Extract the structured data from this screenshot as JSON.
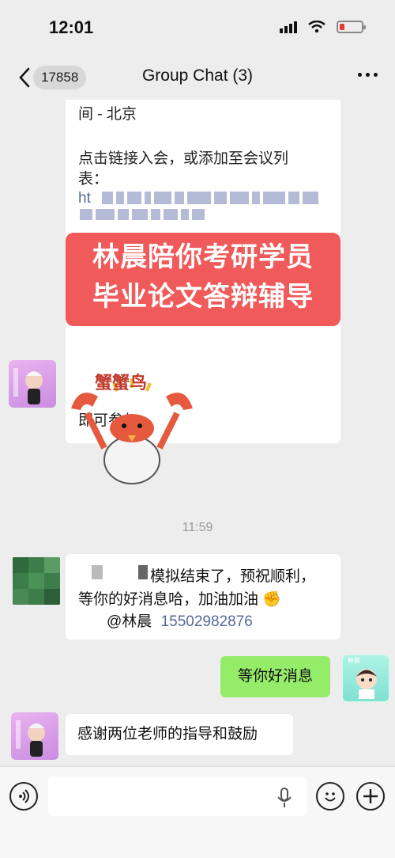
{
  "status_bar": {
    "time": "12:01"
  },
  "nav": {
    "badge": "17858",
    "title": "Group Chat (3)"
  },
  "card": {
    "line1": "间 - 北京",
    "line2": "点击链接入会，或添加至会议列",
    "line3": "表：",
    "link_prefix": "ht",
    "line_bottom": "即可参与"
  },
  "promo": {
    "line1": "林晨陪你考研学员",
    "line2": "毕业论文答辩辅导"
  },
  "sticker": {
    "text": "蟹蟹鸟"
  },
  "time_divider": "11:59",
  "messages": {
    "m1_line1": "模拟结束了，预祝顺利，",
    "m1_line2": "等你的好消息哈，加油加油",
    "m1_line2_emoji": "✊",
    "m1_mention": "@林晨",
    "m1_phone": "15502982876",
    "m2": "等你好消息",
    "m3": "感谢两位老师的指导和鼓励"
  },
  "avatar": {
    "me_label": "林晨"
  },
  "input": {
    "placeholder": ""
  },
  "colors": {
    "accent_green": "#95ec69",
    "promo_red": "#f05a5a",
    "link_blue": "#576b95"
  }
}
